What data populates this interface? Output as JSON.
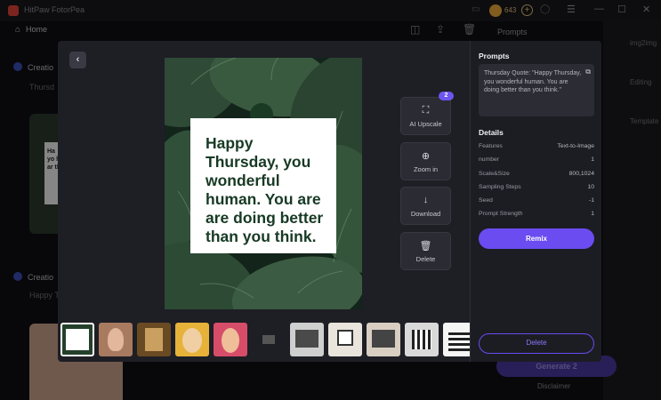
{
  "app": {
    "title": "HitPaw FotorPea",
    "coins": "643",
    "coin_plus": "+"
  },
  "nav": {
    "home_label": "Home"
  },
  "background": {
    "creation_label_1": "Creatio",
    "creation_sub_1": "Thursd",
    "creation_label_2": "Creatio",
    "creation_sub_2": "Happy T",
    "card_snippet": "Ha yo ho ar th",
    "prompts_label": "Prompts",
    "img2img": "img2img",
    "editing": "Editing",
    "template": "Template",
    "generate_label": "Generate",
    "generate_cost": "2",
    "disclaimer": "Disclaimer"
  },
  "modal": {
    "back_icon": "chevron-left-icon",
    "quote": "Happy Thursday, you wonderful human. You are are doing better than you think.",
    "tools": {
      "upscale": "AI Upscale",
      "upscale_badge": "2",
      "zoom": "Zoom in",
      "download": "Download",
      "delete": "Delete"
    },
    "thumbnails_count": 11,
    "side": {
      "prompts_heading": "Prompts",
      "prompt_text": "Thursday Quote: \"Happy Thursday, you wonderful human. You are doing better than you think.\"",
      "details_heading": "Details",
      "details": [
        {
          "label": "Features",
          "value": "Text-to-Image"
        },
        {
          "label": "number",
          "value": "1"
        },
        {
          "label": "Scale&Size",
          "value": "800,1024"
        },
        {
          "label": "Sampling Steps",
          "value": "10"
        },
        {
          "label": "Seed",
          "value": "-1"
        },
        {
          "label": "Prompt Strength",
          "value": "1"
        }
      ],
      "remix_label": "Remix",
      "delete_label": "Delete"
    }
  },
  "colors": {
    "accent": "#6a4cf0",
    "quote_text": "#173a24",
    "modal_bg": "#1e1e25"
  }
}
